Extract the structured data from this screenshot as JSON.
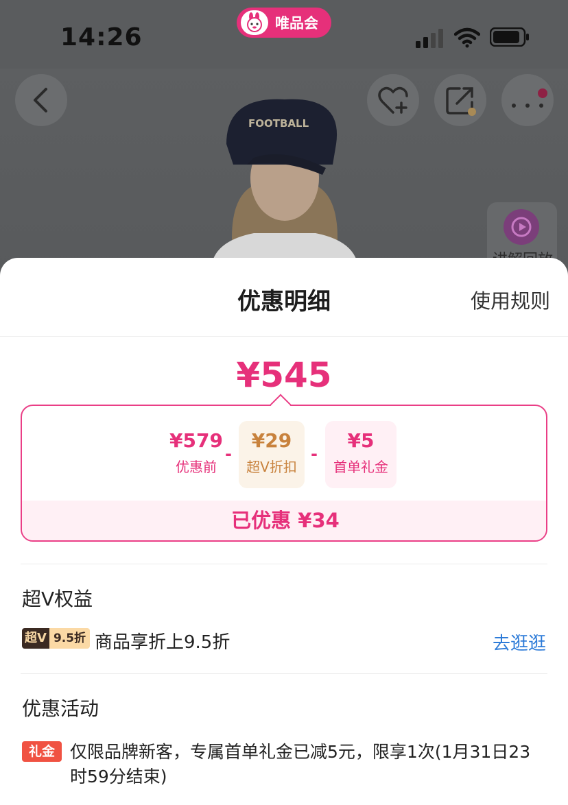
{
  "status_bar": {
    "time": "14:26",
    "brand_name": "唯品会"
  },
  "product_page": {
    "replay_label": "讲解回放"
  },
  "sheet": {
    "title": "优惠明细",
    "rules_link": "使用规则",
    "final_price": "¥545",
    "breakdown": {
      "original_value": "¥579",
      "original_label": "优惠前",
      "svip_value": "¥29",
      "svip_label": "超V折扣",
      "gift_value": "¥5",
      "gift_label": "首单礼金",
      "minus_sign": "-",
      "saved_text": "已优惠 ¥34"
    },
    "svip_section": {
      "title": "超V权益",
      "badge_left": "超V",
      "badge_right": "9.5折",
      "description": "商品享折上9.5折",
      "link": "去逛逛"
    },
    "activity_section": {
      "title": "优惠活动",
      "badge": "礼金",
      "description": "仅限品牌新客，专属首单礼金已减5元，限享1次(1月31日23时59分结束)"
    }
  },
  "colors": {
    "accent_pink": "#e6307a",
    "svip_gold": "#c8823d",
    "link_blue": "#2d7bd8",
    "gift_red": "#f05242"
  }
}
